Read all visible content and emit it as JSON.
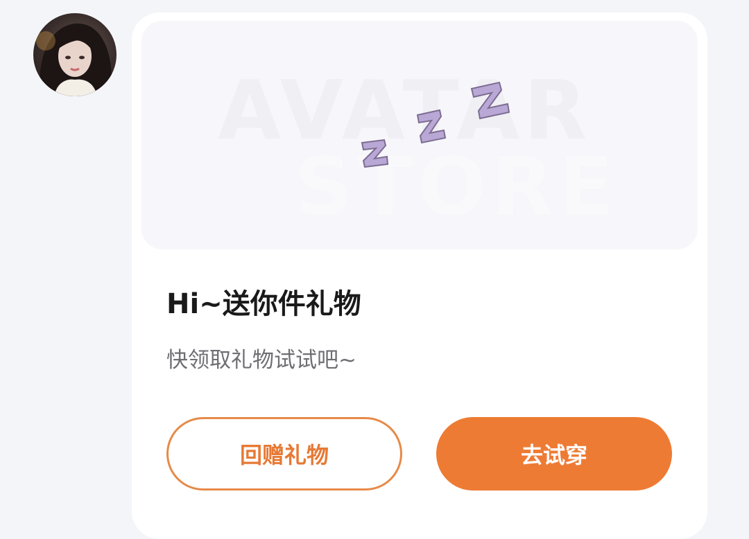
{
  "profile": {
    "avatar_icon": "user-avatar-photo"
  },
  "gift_card": {
    "banner": {
      "watermark_line1": "AVATAR",
      "watermark_line2": "STORE",
      "sleep_icon": "zzz-icon",
      "sleep_color": "#b9a8d6"
    },
    "title": "Hi~送你件礼物",
    "subtitle": "快领取礼物试试吧~",
    "buttons": {
      "return_gift": "回赠礼物",
      "try_on": "去试穿"
    },
    "colors": {
      "accent": "#ee7b34",
      "card_bg": "#ffffff",
      "page_bg": "#f4f5f9"
    }
  }
}
